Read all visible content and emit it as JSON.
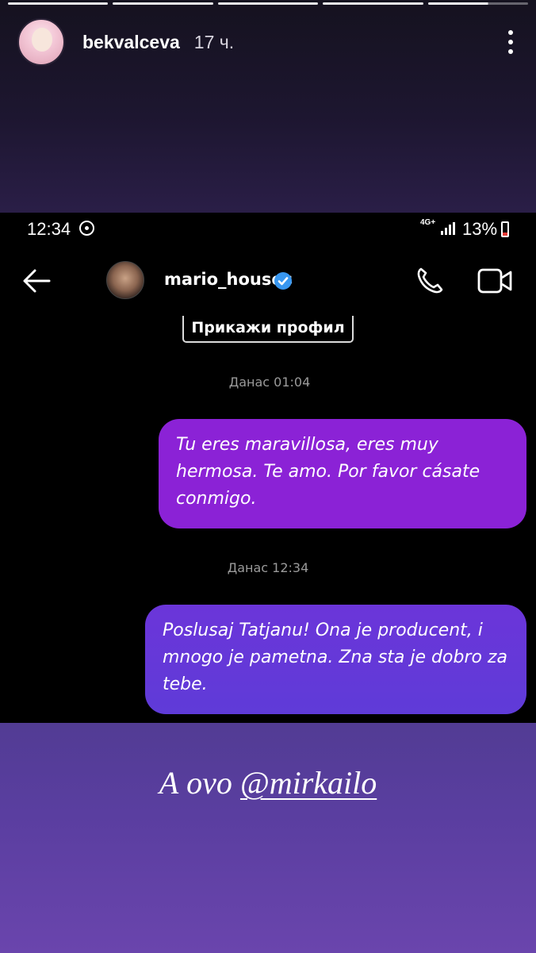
{
  "story": {
    "username": "bekvalceva",
    "time": "17 ч.",
    "progress_segments": [
      1,
      1,
      1,
      1,
      0.6
    ],
    "caption_text": "А ovo ",
    "caption_mention": "@mirkailo"
  },
  "status_bar": {
    "time": "12:34",
    "network": "4G+",
    "battery": "13%"
  },
  "dm": {
    "username": "mario_houses",
    "view_profile_label": "Прикажи профил",
    "messages": [
      {
        "date": "Данас 01:04",
        "text": "Tu eres maravillosa, eres muy hermosa. Te amo. Por favor cásate conmigo."
      },
      {
        "date": "Данас 12:34",
        "text": "Poslusaj Tatjanu! Ona je producent, i mnogo je pametna. Zna sta je dobro za tebe."
      }
    ]
  },
  "colors": {
    "bubble_one": "#8b22d6",
    "bubble_two": "#6b35d9",
    "caption_bg": "#5a3ea0",
    "verified": "#3897f0"
  },
  "icons": [
    "more-vertical-icon",
    "sync-icon",
    "signal-icon",
    "battery-icon",
    "back-arrow-icon",
    "verified-badge-icon",
    "phone-call-icon",
    "video-call-icon"
  ]
}
